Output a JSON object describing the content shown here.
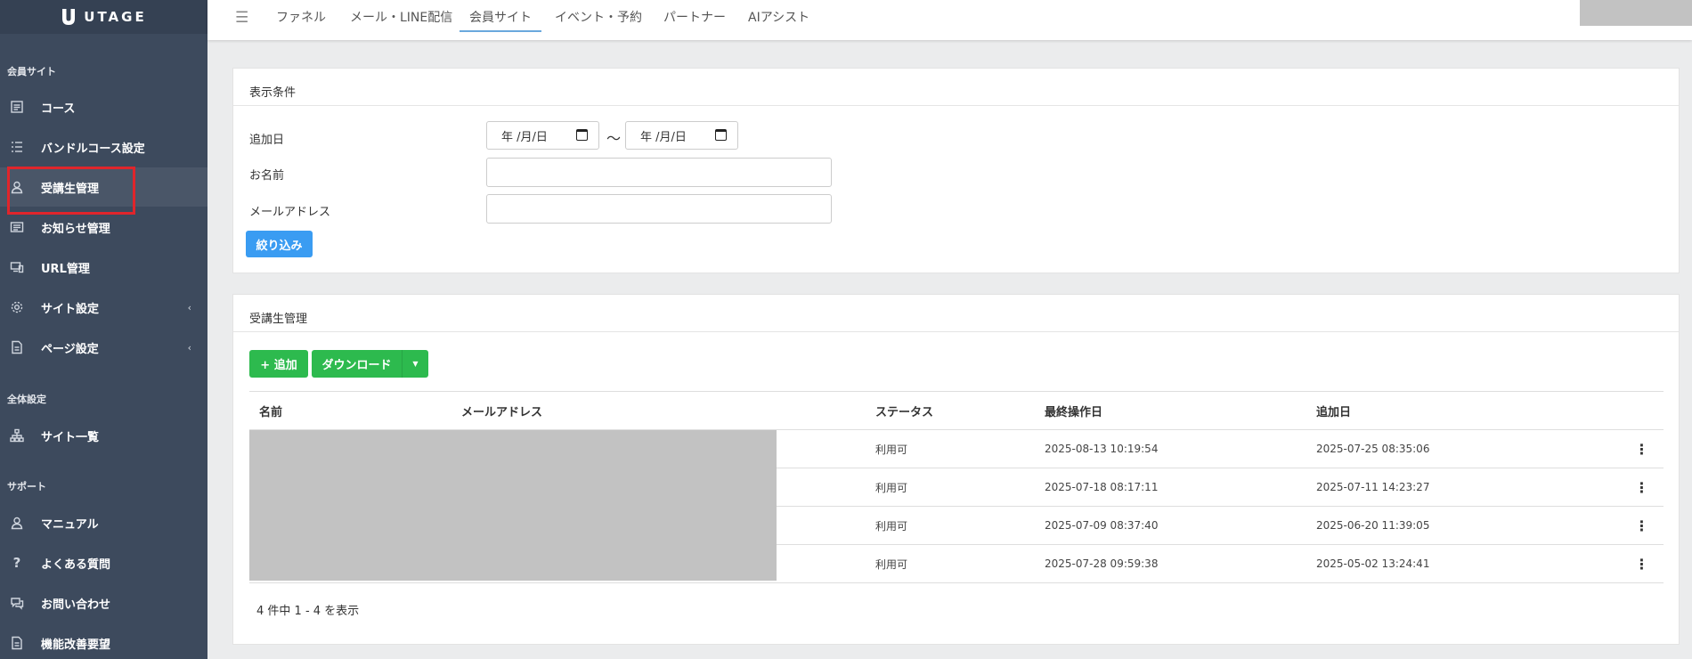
{
  "app": {
    "logo_text": "UTAGE"
  },
  "sidebar": {
    "section_member": "会員サイト",
    "section_global": "全体設定",
    "section_support": "サポート",
    "items": [
      {
        "label": "コース",
        "icon": "list-icon"
      },
      {
        "label": "バンドルコース設定",
        "icon": "bullet-list-icon"
      },
      {
        "label": "受講生管理",
        "icon": "user-icon"
      },
      {
        "label": "お知らせ管理",
        "icon": "newspaper-icon"
      },
      {
        "label": "URL管理",
        "icon": "devices-icon"
      },
      {
        "label": "サイト設定",
        "icon": "gear-icon",
        "chevron": "‹"
      },
      {
        "label": "ページ設定",
        "icon": "document-icon",
        "chevron": "‹"
      },
      {
        "label": "サイト一覧",
        "icon": "sitemap-icon"
      },
      {
        "label": "マニュアル",
        "icon": "user-icon"
      },
      {
        "label": "よくある質問",
        "icon": "question-icon"
      },
      {
        "label": "お問い合わせ",
        "icon": "chat-icon"
      },
      {
        "label": "機能改善要望",
        "icon": "document-icon"
      }
    ]
  },
  "topnav": {
    "menu_glyph": "☰",
    "tabs": [
      "ファネル",
      "メール・LINE配信",
      "会員サイト",
      "イベント・予約",
      "パートナー",
      "AIアシスト"
    ],
    "active_tab": "会員サイト"
  },
  "filter": {
    "title": "表示条件",
    "added_date_label": "追加日",
    "date_from_placeholder": "年 /月/日",
    "date_to_placeholder": "年 /月/日",
    "tilde": "〜",
    "name_label": "お名前",
    "email_label": "メールアドレス",
    "submit_label": "絞り込み"
  },
  "members": {
    "title": "受講生管理",
    "add_label": "+ 追加",
    "download_label": "ダウンロード",
    "columns": [
      "名前",
      "メールアドレス",
      "ステータス",
      "最終操作日",
      "追加日"
    ],
    "rows": [
      {
        "status": "利用可",
        "last_action": "2025-08-13 10:19:54",
        "added": "2025-07-25 08:35:06"
      },
      {
        "status": "利用可",
        "last_action": "2025-07-18 08:17:11",
        "added": "2025-07-11 14:23:27"
      },
      {
        "status": "利用可",
        "last_action": "2025-07-09 08:37:40",
        "added": "2025-06-20 11:39:05"
      },
      {
        "status": "利用可",
        "last_action": "2025-07-28 09:59:38",
        "added": "2025-05-02 13:24:41"
      }
    ],
    "row_menu_glyph": "⋮",
    "pagination": "4 件中 1 - 4 を表示"
  },
  "colors": {
    "sidebar_bg": "#3d4a5d",
    "primary_blue": "#3a9cf2",
    "success_green": "#2dba4e",
    "highlight_red": "#e0252b"
  }
}
